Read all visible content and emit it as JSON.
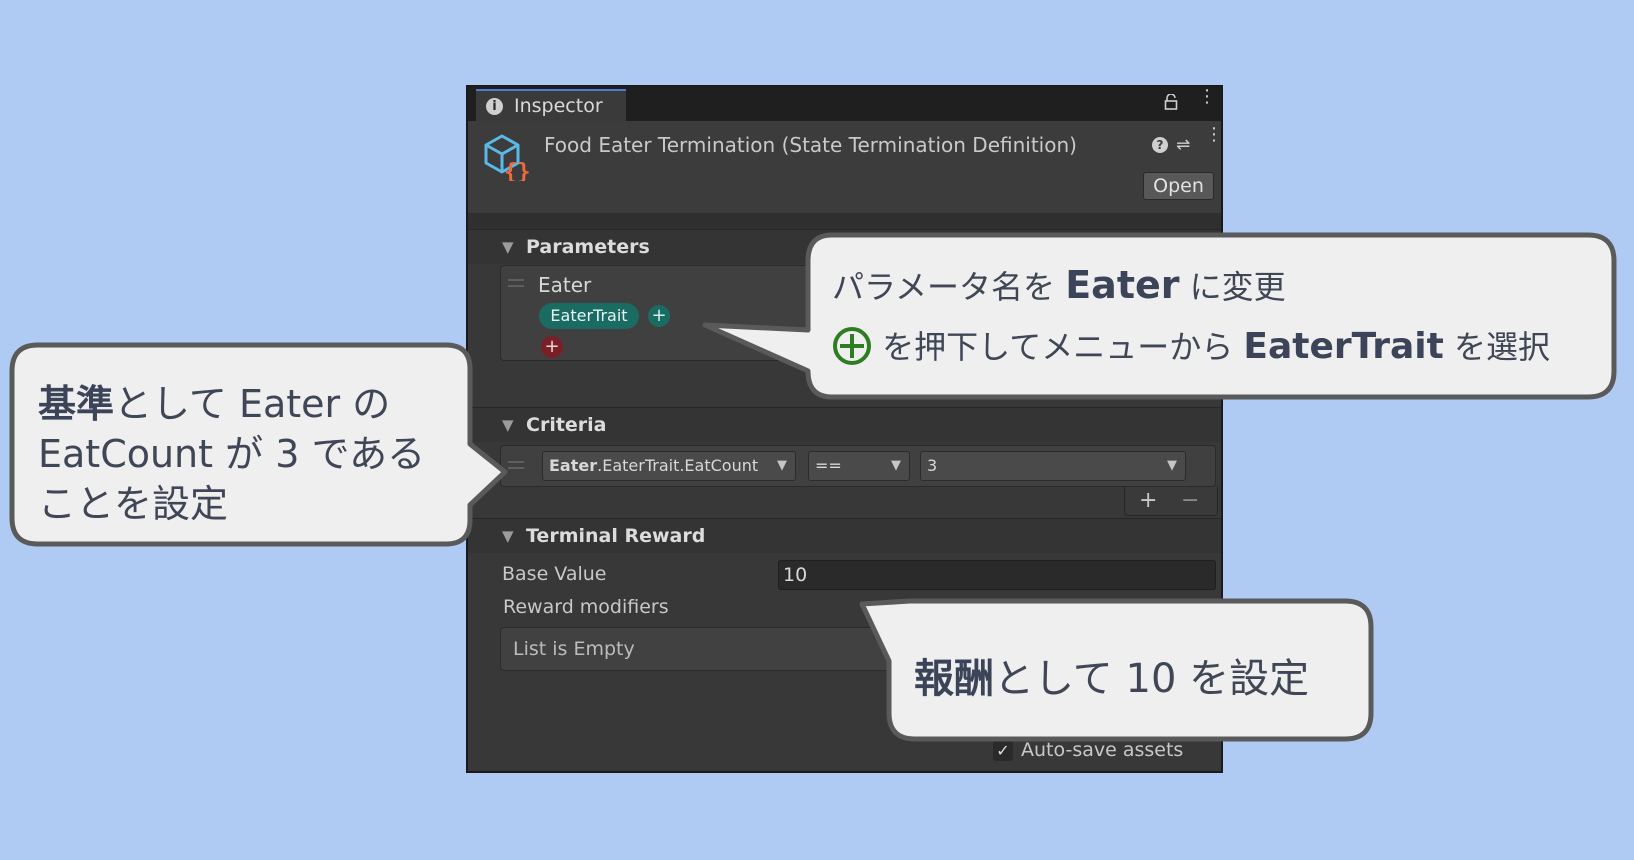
{
  "inspector": {
    "tab_label": "Inspector",
    "asset_title": "Food Eater Termination (State Termination Definition)",
    "open_label": "Open",
    "parameters": {
      "title": "Parameters",
      "param_name": "Eater",
      "trait_label": "EaterTrait"
    },
    "criteria": {
      "title": "Criteria",
      "field_bold": "Eater",
      "field_rest": ".EaterTrait.EatCount",
      "operator": "==",
      "value": "3"
    },
    "terminal_reward": {
      "title": "Terminal Reward",
      "base_value_label": "Base Value",
      "base_value": "10",
      "modifiers_label": "Reward modifiers",
      "empty_list": "List is Empty"
    },
    "autosave_label": "Auto-save assets"
  },
  "callouts": {
    "params": {
      "line1_a": "パラメータ名を ",
      "line1_bold": "Eater",
      "line1_b": " に変更",
      "line2_a": " を押下してメニューから ",
      "line2_bold": "EaterTrait",
      "line2_b": " を選択"
    },
    "criteria": {
      "line1_bold": "基準",
      "line1_rest": "として Eater の",
      "line2": "EatCount が 3 である",
      "line3": "ことを設定"
    },
    "reward": {
      "bold": "報酬",
      "rest": "として 10 を設定"
    }
  },
  "colors": {
    "background": "#afcaf3",
    "panel": "#383838",
    "callout_fill": "#efefef",
    "callout_border": "#5a5a5a",
    "trait_pill": "#1a6c63",
    "remove_button": "#7a1f28",
    "plus_circle": "#2e7d22"
  }
}
